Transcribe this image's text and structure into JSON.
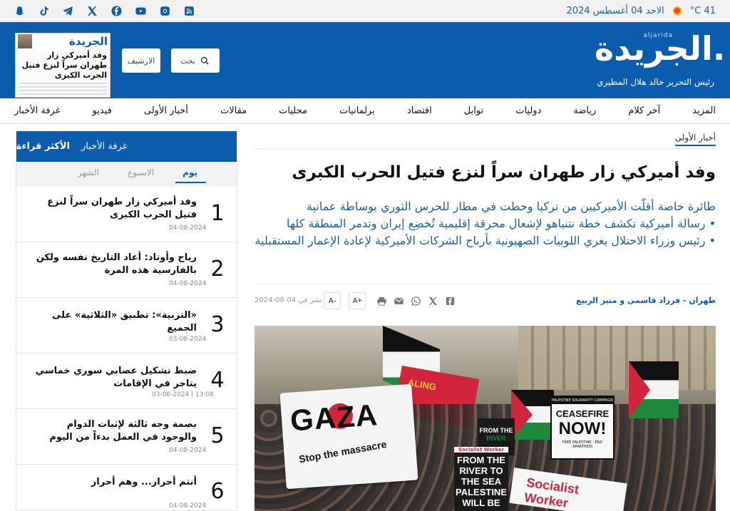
{
  "topbar": {
    "temperature": "41 C°",
    "date": "الاحد 04 أغسطس 2024",
    "socials": [
      "rss-icon",
      "instagram-icon",
      "youtube-icon",
      "facebook-icon",
      "x-icon",
      "telegram-icon",
      "tiktok-icon",
      "snapchat-icon"
    ]
  },
  "header": {
    "logo": "الجريدة.",
    "logo_latin": "aljarida",
    "editor": "رئيس التحرير خالد هلال المطيري",
    "search_label": "بحث",
    "archive_label": "الارشيف",
    "paper_title": "الجريدة",
    "paper_headline": "وفد أميركي زار طهران سراً لنزع فتيل الحرب الكبرى"
  },
  "nav": {
    "items": [
      "غرفة الأخبار",
      "فيديو",
      "أخبار الأولى",
      "مقالات",
      "محليات",
      "برلمانيات",
      "اقتصاد",
      "توابل",
      "دوليات",
      "رياضة",
      "آخر كلام",
      "المزيد"
    ]
  },
  "sidebar": {
    "tabs": [
      "الأكثر قراءة",
      "غرفة الأخبار"
    ],
    "periods": [
      "يوم",
      "الاسبوع",
      "الشهر"
    ],
    "items": [
      {
        "num": "1",
        "title": "وفد أميركي زار طهران سراً لنزع فتيل الحرب الكبرى",
        "date": "04-08-2024"
      },
      {
        "num": "2",
        "title": "رياح وأوتاد: أعاد التاريخ نفسه ولكن بالفارسية هذه المرة",
        "date": "04-08-2024"
      },
      {
        "num": "3",
        "title": "«التربية»: تطبيق «الثلاثية» على الجميع",
        "date": "03-08-2024"
      },
      {
        "num": "4",
        "title": "ضبط تشكيل عصابي سوري خماسي يتاجر في الإقامات",
        "date": "03-08-2024 | 13:08"
      },
      {
        "num": "5",
        "title": "بصمة وجه ثالثة لإثبات الدوام والوجود في العمل بدءاً من اليوم",
        "date": "04-08-2024"
      },
      {
        "num": "6",
        "title": "أنتم أحرار... وهم أحرار",
        "date": "04-08-2024"
      }
    ]
  },
  "article": {
    "section": "أخبار الأولى",
    "headline": "وفد أميركي زار طهران سراً لنزع فتيل الحرب الكبرى",
    "summary": [
      "طائرة خاصة أقلّت الأميركيين من تركيا وحطت في مطار للحرس الثوري بوساطة عمانية",
      "• رسالة أميركية تكشف خطة نتنياهو لإشعال محرقة إقليمية تُخضِع إيران وتدمر المنطقة كلها",
      "• رئيس وزراء الاحتلال يغري اللوبيات الصهيونية بأرباح الشركات الأميركية لإعادة الإعمار المستقبلية"
    ],
    "byline": "طهران - فرزاد قاسمي و منير الربيع",
    "pubdate": "نشر في 04-08-2024",
    "font_plus": "A+",
    "font_minus": "A-",
    "share_icons": [
      "facebook-share-icon",
      "x-share-icon",
      "whatsapp-share-icon",
      "email-share-icon",
      "print-icon"
    ]
  },
  "photo": {
    "gaza_word": "GAZA",
    "gaza_sub": "Stop the massacre",
    "cease_top": "PALESTINE SOLIDARITY CAMPAIGN",
    "cease_1": "CEASEFIRE",
    "cease_2": "NOW!",
    "cease_3": "FREE PALESTINE - END APARTHEID",
    "river_sw": "Socialist Worker",
    "river_txt": "FROM THE RIVER TO THE SEA PALESTINE WILL BE",
    "banner_red": "ALING",
    "sign_sw2": "Socialist Worker",
    "fromriver_a": "FROM THE",
    "fromriver_b": "RIVER"
  },
  "colors": {
    "brand_blue": "#0b5cad",
    "summary_blue": "#1a5fa8"
  }
}
